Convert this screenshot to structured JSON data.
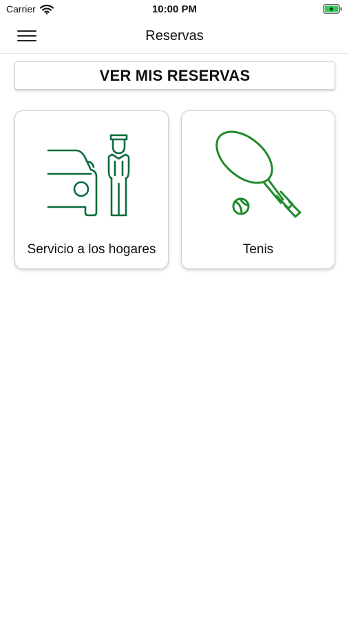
{
  "status_bar": {
    "carrier": "Carrier",
    "time": "10:00 PM",
    "icons": [
      "wifi-icon",
      "battery-charging-icon"
    ],
    "battery_color": "#34c759"
  },
  "nav": {
    "title": "Reservas",
    "menu_icon": "hamburger-menu-icon"
  },
  "main": {
    "ver_button_label": "VER MIS RESERVAS",
    "cards": [
      {
        "label": "Servicio a los hogares",
        "icon": "car-and-chauffeur-icon",
        "icon_color": "#0b6b3a"
      },
      {
        "label": "Tenis",
        "icon": "tennis-racket-icon",
        "icon_color": "#1f8a2a"
      }
    ]
  }
}
